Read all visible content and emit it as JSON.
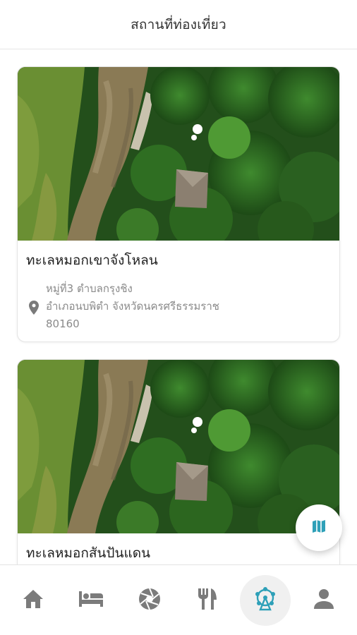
{
  "header": {
    "title": "สถานที่ท่องเที่ยว"
  },
  "places": [
    {
      "name": "ทะเลหมอกเขาจังโหลน",
      "address_lines": [
        "หมู่ที่3 ตำบลกรุงชิง",
        "อำเภอนบพิตำ จังหวัดนครศรีธรรมราช",
        "80160"
      ],
      "photo_icon": "aerial-forest-photo"
    },
    {
      "name": "ทะเลหมอกสันปันแดน",
      "photo_icon": "aerial-forest-photo"
    }
  ],
  "map_button": {
    "icon": "map-icon"
  },
  "bottom_nav": {
    "active": "attractions",
    "items": [
      {
        "id": "home",
        "icon": "home-icon"
      },
      {
        "id": "hotel",
        "icon": "bed-icon"
      },
      {
        "id": "camera",
        "icon": "camera-aperture-icon"
      },
      {
        "id": "restaurant",
        "icon": "fork-knife-icon"
      },
      {
        "id": "attractions",
        "icon": "ferris-wheel-icon"
      },
      {
        "id": "profile",
        "icon": "person-icon"
      }
    ]
  },
  "colors": {
    "accent": "#2ea0b8",
    "nav_icon": "#7b7b7b",
    "text_primary": "#1f1f1f",
    "text_secondary": "#8a8a8a"
  }
}
